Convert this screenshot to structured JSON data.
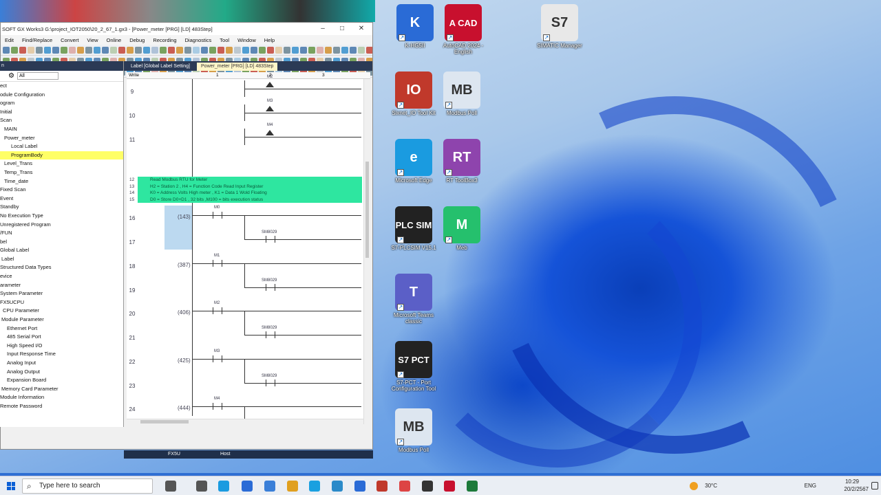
{
  "window": {
    "title": "SOFT GX Works3 G:\\project_IOT2050\\20_2_67_1.gx3 - [Power_meter [PRG] [LD] 483Step]"
  },
  "menu": [
    "Edit",
    "Find/Replace",
    "Convert",
    "View",
    "Online",
    "Debug",
    "Recording",
    "Diagnostics",
    "Tool",
    "Window",
    "Help"
  ],
  "navigation": {
    "filter": "All",
    "items": [
      "ect",
      "odule Configuration",
      "ogram",
      "Initial",
      "Scan",
      "MAIN",
      "Power_meter",
      "Local Label",
      "ProgramBody",
      "Level_Trans",
      "Temp_Trans",
      "Time_date",
      "Fixed Scan",
      "Event",
      "Standby",
      "No Execution Type",
      "Unregistered Program",
      "/FUN",
      "bel",
      "Global Label",
      "Label",
      "Structured Data Types",
      "evice",
      "arameter",
      "System Parameter",
      "FX5UCPU",
      "CPU Parameter",
      "Module Parameter",
      "Ethernet Port",
      "485 Serial Port",
      "High Speed I/O",
      "Input Response Time",
      "Analog Input",
      "Analog Output",
      "Expansion Board",
      "Memory Card Parameter",
      "Module Information",
      "Remote Password"
    ]
  },
  "tabs": [
    "Label [Global Label Setting]",
    "Power_meter [PRG] [LD] 483Step"
  ],
  "editor": {
    "mode": "Write",
    "columns": [
      "1",
      "2",
      "3"
    ],
    "comments": [
      "Read Modbus RTU for Meter",
      "H2 = Station 2 , H4 = Function Code Read Input Register",
      "K0 = Address Volts  High meter , K1 = Data 1 Wold Floating",
      "D0 = Store D0+D1 , 32 bits ,M100 = bits execution status"
    ],
    "rows_top": [
      {
        "n": "9",
        "dev": "M2"
      },
      {
        "n": "10",
        "dev": "M3"
      },
      {
        "n": "11",
        "dev": "M4"
      }
    ],
    "rungs": [
      {
        "n1": "16",
        "n2": "17",
        "step": "(143)",
        "dev": "M0",
        "dev2": "SM8029"
      },
      {
        "n1": "18",
        "n2": "19",
        "step": "(387)",
        "dev": "M1",
        "dev2": "SM8029"
      },
      {
        "n1": "20",
        "n2": "21",
        "step": "(406)",
        "dev": "M2",
        "dev2": "SM8029"
      },
      {
        "n1": "22",
        "n2": "23",
        "step": "(425)",
        "dev": "M3",
        "dev2": "SM8029"
      },
      {
        "n1": "24",
        "n2": "25",
        "step": "(444)",
        "dev": "M4",
        "dev2": "SM8029"
      }
    ]
  },
  "statusbar": {
    "cpu": "FX5U",
    "conn": "Host"
  },
  "desktop_icons": [
    {
      "label": "K-HG5II",
      "color": "#2a6bd6",
      "glyph": "K"
    },
    {
      "label": "AutoCAD 2024 - English",
      "color": "#c8102e",
      "glyph": "A CAD"
    },
    {
      "label": "SIMATIC Manager",
      "color": "#e8e8e8",
      "glyph": "S7"
    },
    {
      "label": "Sixnet_IO Tool Kit",
      "color": "#c0392b",
      "glyph": "IO"
    },
    {
      "label": "Modbus Poll",
      "color": "#dde6f0",
      "glyph": "MB"
    },
    {
      "label": "Microsoft Edge",
      "color": "#1a9be0",
      "glyph": "e"
    },
    {
      "label": "RT ToolBox3",
      "color": "#8e44ad",
      "glyph": "RT"
    },
    {
      "label": "S7-PLCSIM V15.1",
      "color": "#222",
      "glyph": "PLC SIM"
    },
    {
      "label": "Meb",
      "color": "#25c06d",
      "glyph": "M"
    },
    {
      "label": "Microsoft Teams classic",
      "color": "#5b5fc7",
      "glyph": "T"
    },
    {
      "label": "S7-PCT - Port Configuration Tool",
      "color": "#222",
      "glyph": "S7 PCT"
    },
    {
      "label": "Modbus Poll",
      "color": "#dde6f0",
      "glyph": "MB"
    }
  ],
  "taskbar": {
    "search_placeholder": "Type here to search",
    "weather": "30°C",
    "lang": "ENG",
    "time": "10:29",
    "date": "20/2/2567"
  }
}
